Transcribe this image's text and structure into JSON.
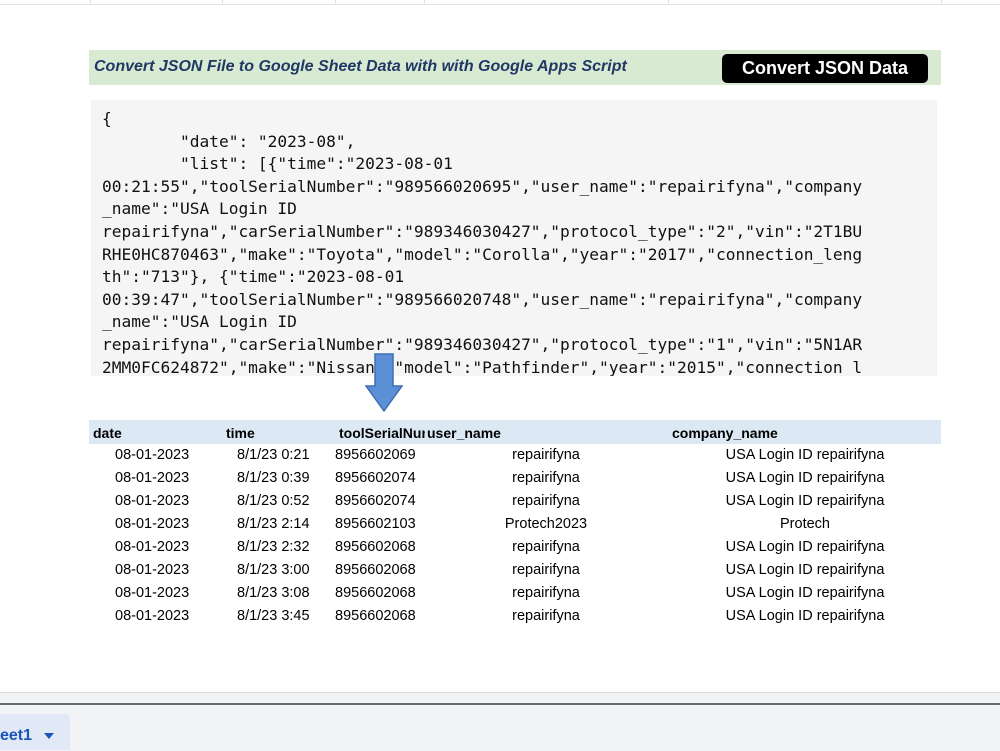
{
  "banner": {
    "title": "Convert JSON File to Google Sheet Data with with Google Apps Script",
    "button_label": "Convert JSON Data"
  },
  "json_preview": {
    "lines": [
      "{",
      "        \"date\": \"2023-08\",",
      "        \"list\": [{\"time\":\"2023-08-01",
      "00:21:55\",\"toolSerialNumber\":\"989566020695\",\"user_name\":\"repairifyna\",\"company",
      "_name\":\"USA Login ID",
      "repairifyna\",\"carSerialNumber\":\"989346030427\",\"protocol_type\":\"2\",\"vin\":\"2T1BU",
      "RHE0HC870463\",\"make\":\"Toyota\",\"model\":\"Corolla\",\"year\":\"2017\",\"connection_leng",
      "th\":\"713\"}, {\"time\":\"2023-08-01",
      "00:39:47\",\"toolSerialNumber\":\"989566020748\",\"user_name\":\"repairifyna\",\"company",
      "_name\":\"USA Login ID",
      "repairifyna\",\"carSerialNumber\":\"989346030427\",\"protocol_type\":\"1\",\"vin\":\"5N1AR",
      "2MM0FC624872\",\"make\":\"Nissan\",\"model\":\"Pathfinder\",\"year\":\"2015\",\"connection_l"
    ]
  },
  "arrow_icon": "down-arrow-icon",
  "table": {
    "headers": {
      "date": "date",
      "time": "time",
      "tool_serial": "toolSerialNumber",
      "user_name": "user_name",
      "company_name": "company_name"
    },
    "rows": [
      {
        "date": "08-01-2023",
        "time": "8/1/23 0:21",
        "tool_serial": "8956602069",
        "user_name": "repairifyna",
        "company_name": "USA Login ID repairifyna"
      },
      {
        "date": "08-01-2023",
        "time": "8/1/23 0:39",
        "tool_serial": "8956602074",
        "user_name": "repairifyna",
        "company_name": "USA Login ID repairifyna"
      },
      {
        "date": "08-01-2023",
        "time": "8/1/23 0:52",
        "tool_serial": "8956602074",
        "user_name": "repairifyna",
        "company_name": "USA Login ID repairifyna"
      },
      {
        "date": "08-01-2023",
        "time": "8/1/23 2:14",
        "tool_serial": "8956602103",
        "user_name": "Protech2023",
        "company_name": "Protech"
      },
      {
        "date": "08-01-2023",
        "time": "8/1/23 2:32",
        "tool_serial": "8956602068",
        "user_name": "repairifyna",
        "company_name": "USA Login ID repairifyna"
      },
      {
        "date": "08-01-2023",
        "time": "8/1/23 3:00",
        "tool_serial": "8956602068",
        "user_name": "repairifyna",
        "company_name": "USA Login ID repairifyna"
      },
      {
        "date": "08-01-2023",
        "time": "8/1/23 3:08",
        "tool_serial": "8956602068",
        "user_name": "repairifyna",
        "company_name": "USA Login ID repairifyna"
      },
      {
        "date": "08-01-2023",
        "time": "8/1/23 3:45",
        "tool_serial": "8956602068",
        "user_name": "repairifyna",
        "company_name": "USA Login ID repairifyna"
      }
    ]
  },
  "sheet_tab": {
    "label": "eet1",
    "dropdown_icon": "caret-down-icon"
  },
  "colors": {
    "banner_bg": "#d9ead3",
    "banner_title": "#1f3864",
    "button_bg": "#000000",
    "json_bg": "#f5f5f5",
    "header_bg": "#dce9f5",
    "arrow_fill": "#5b8fd6",
    "tab_text": "#1a56b7"
  }
}
